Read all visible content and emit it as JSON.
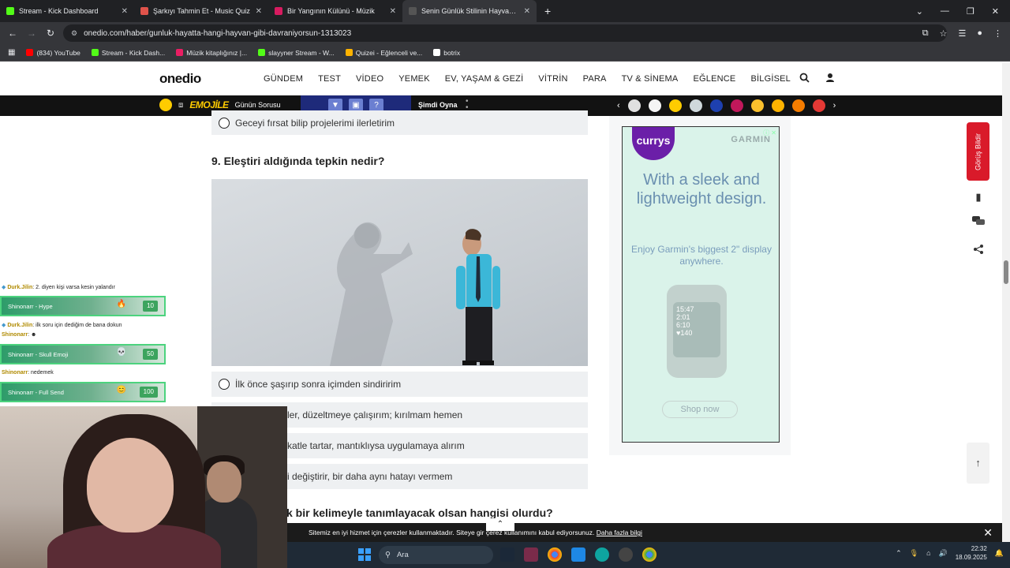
{
  "browser": {
    "tabs": [
      {
        "title": "Stream - Kick Dashboard",
        "color": "#53fc18",
        "active": false
      },
      {
        "title": "Şarkıyı Tahmin Et - Music Quiz",
        "color": "#e0534b",
        "active": false
      },
      {
        "title": "Bir Yangının Külünü - Müzik",
        "color": "#d81b60",
        "active": false
      },
      {
        "title": "Senin Günlük Stilinin Hayvan K...",
        "color": "#333333",
        "active": true
      }
    ],
    "new_tab": "+",
    "url": "onedio.com/haber/gunluk-hayatta-hangi-hayvan-gibi-davraniyorsun-1313023",
    "bookmarks": [
      {
        "label": "(834) YouTube",
        "color": "#ff0000"
      },
      {
        "label": "Stream - Kick Dash...",
        "color": "#53fc18"
      },
      {
        "label": "Müzik kitaplığınız |...",
        "color": "#e91e63"
      },
      {
        "label": "slayyner Stream - W...",
        "color": "#53fc18"
      },
      {
        "label": "Quizei - Eğlenceli ve...",
        "color": "#ffb300"
      },
      {
        "label": "botrix",
        "color": "#ffffff"
      }
    ]
  },
  "site": {
    "logo": "onedio",
    "nav": [
      "GÜNDEM",
      "TEST",
      "VİDEO",
      "YEMEK",
      "EV, YAŞAM & GEZİ",
      "VİTRİN",
      "PARA",
      "TV & SİNEMA",
      "EĞLENCE",
      "BİLGİSEL"
    ],
    "emojile": "EMOJİLE",
    "gunun_sorusu": "Günün Sorusu",
    "simdi_oyna": "Şimdi Oyna",
    "puzzle_q": "?"
  },
  "quiz": {
    "prev_option": "Geceyi fırsat bilip projelerimi ilerletirim",
    "question_title": "9. Eleştiri aldığında tepkin nedir?",
    "options": [
      "İlk önce şaşırıp sonra içimden sindiririm",
      "ler, düzeltmeye çalışırım; kırılmam hemen",
      "katle tartar, mantıklıysa uygulamaya alırım",
      "i değiştirir, bir daha aynı hatayı vermem"
    ],
    "next_question": "k bir kelimeyle tanımlayacak olsan hangisi olurdu?"
  },
  "ad": {
    "brand": "currys",
    "partner": "GARMIN",
    "headline": "With a sleek and lightweight design.",
    "sub": "Enjoy Garmin's biggest 2\" display anywhere.",
    "cta": "Shop now",
    "watch_lines": [
      "15:47",
      "2:01",
      "6:10",
      "♥140"
    ]
  },
  "sidebar": {
    "feedback": "Görüş Bildir"
  },
  "stream_chat": {
    "lines": [
      {
        "user": "Durk.Jilin",
        "text": ": 2. diyen kişi varsa kesin yalandır"
      },
      {
        "user": "Durk.Jilin",
        "text": ": ilk soru için dediğim de bana dokun"
      },
      {
        "user": "Shinonarr",
        "text": ": ☻"
      },
      {
        "user": "Shinonarr",
        "text": ": nedemek"
      }
    ],
    "alerts": [
      {
        "text": "Shinonarr - Hype",
        "amount": "10"
      },
      {
        "text": "Shinonarr - Skull Emoji",
        "amount": "50"
      },
      {
        "text": "Shinonarr - Full Send",
        "amount": "100"
      }
    ]
  },
  "cookie": {
    "text": "Sitemiz en iyi hizmet için çerezler kullanmaktadır. Siteye gir",
    "text2": "çerez kullanımını kabul ediyorsunuz.",
    "more": "Daha fazla bilgi"
  },
  "taskbar": {
    "search": "Ara",
    "time": "22:32",
    "date": "18.09.2025"
  }
}
